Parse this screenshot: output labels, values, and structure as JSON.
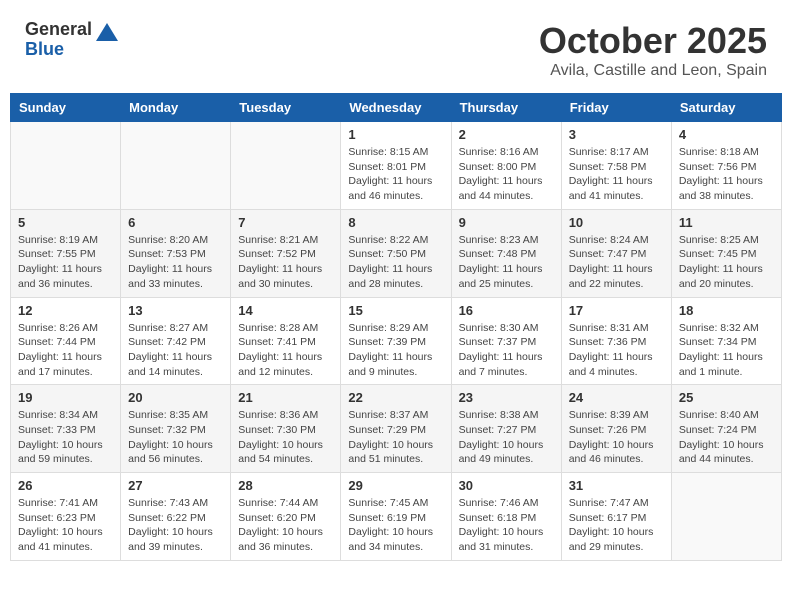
{
  "logo": {
    "general": "General",
    "blue": "Blue"
  },
  "title": {
    "month_year": "October 2025",
    "location": "Avila, Castille and Leon, Spain"
  },
  "weekdays": [
    "Sunday",
    "Monday",
    "Tuesday",
    "Wednesday",
    "Thursday",
    "Friday",
    "Saturday"
  ],
  "weeks": [
    [
      null,
      null,
      null,
      {
        "day": 1,
        "sunrise": "Sunrise: 8:15 AM",
        "sunset": "Sunset: 8:01 PM",
        "daylight": "Daylight: 11 hours and 46 minutes."
      },
      {
        "day": 2,
        "sunrise": "Sunrise: 8:16 AM",
        "sunset": "Sunset: 8:00 PM",
        "daylight": "Daylight: 11 hours and 44 minutes."
      },
      {
        "day": 3,
        "sunrise": "Sunrise: 8:17 AM",
        "sunset": "Sunset: 7:58 PM",
        "daylight": "Daylight: 11 hours and 41 minutes."
      },
      {
        "day": 4,
        "sunrise": "Sunrise: 8:18 AM",
        "sunset": "Sunset: 7:56 PM",
        "daylight": "Daylight: 11 hours and 38 minutes."
      }
    ],
    [
      {
        "day": 5,
        "sunrise": "Sunrise: 8:19 AM",
        "sunset": "Sunset: 7:55 PM",
        "daylight": "Daylight: 11 hours and 36 minutes."
      },
      {
        "day": 6,
        "sunrise": "Sunrise: 8:20 AM",
        "sunset": "Sunset: 7:53 PM",
        "daylight": "Daylight: 11 hours and 33 minutes."
      },
      {
        "day": 7,
        "sunrise": "Sunrise: 8:21 AM",
        "sunset": "Sunset: 7:52 PM",
        "daylight": "Daylight: 11 hours and 30 minutes."
      },
      {
        "day": 8,
        "sunrise": "Sunrise: 8:22 AM",
        "sunset": "Sunset: 7:50 PM",
        "daylight": "Daylight: 11 hours and 28 minutes."
      },
      {
        "day": 9,
        "sunrise": "Sunrise: 8:23 AM",
        "sunset": "Sunset: 7:48 PM",
        "daylight": "Daylight: 11 hours and 25 minutes."
      },
      {
        "day": 10,
        "sunrise": "Sunrise: 8:24 AM",
        "sunset": "Sunset: 7:47 PM",
        "daylight": "Daylight: 11 hours and 22 minutes."
      },
      {
        "day": 11,
        "sunrise": "Sunrise: 8:25 AM",
        "sunset": "Sunset: 7:45 PM",
        "daylight": "Daylight: 11 hours and 20 minutes."
      }
    ],
    [
      {
        "day": 12,
        "sunrise": "Sunrise: 8:26 AM",
        "sunset": "Sunset: 7:44 PM",
        "daylight": "Daylight: 11 hours and 17 minutes."
      },
      {
        "day": 13,
        "sunrise": "Sunrise: 8:27 AM",
        "sunset": "Sunset: 7:42 PM",
        "daylight": "Daylight: 11 hours and 14 minutes."
      },
      {
        "day": 14,
        "sunrise": "Sunrise: 8:28 AM",
        "sunset": "Sunset: 7:41 PM",
        "daylight": "Daylight: 11 hours and 12 minutes."
      },
      {
        "day": 15,
        "sunrise": "Sunrise: 8:29 AM",
        "sunset": "Sunset: 7:39 PM",
        "daylight": "Daylight: 11 hours and 9 minutes."
      },
      {
        "day": 16,
        "sunrise": "Sunrise: 8:30 AM",
        "sunset": "Sunset: 7:37 PM",
        "daylight": "Daylight: 11 hours and 7 minutes."
      },
      {
        "day": 17,
        "sunrise": "Sunrise: 8:31 AM",
        "sunset": "Sunset: 7:36 PM",
        "daylight": "Daylight: 11 hours and 4 minutes."
      },
      {
        "day": 18,
        "sunrise": "Sunrise: 8:32 AM",
        "sunset": "Sunset: 7:34 PM",
        "daylight": "Daylight: 11 hours and 1 minute."
      }
    ],
    [
      {
        "day": 19,
        "sunrise": "Sunrise: 8:34 AM",
        "sunset": "Sunset: 7:33 PM",
        "daylight": "Daylight: 10 hours and 59 minutes."
      },
      {
        "day": 20,
        "sunrise": "Sunrise: 8:35 AM",
        "sunset": "Sunset: 7:32 PM",
        "daylight": "Daylight: 10 hours and 56 minutes."
      },
      {
        "day": 21,
        "sunrise": "Sunrise: 8:36 AM",
        "sunset": "Sunset: 7:30 PM",
        "daylight": "Daylight: 10 hours and 54 minutes."
      },
      {
        "day": 22,
        "sunrise": "Sunrise: 8:37 AM",
        "sunset": "Sunset: 7:29 PM",
        "daylight": "Daylight: 10 hours and 51 minutes."
      },
      {
        "day": 23,
        "sunrise": "Sunrise: 8:38 AM",
        "sunset": "Sunset: 7:27 PM",
        "daylight": "Daylight: 10 hours and 49 minutes."
      },
      {
        "day": 24,
        "sunrise": "Sunrise: 8:39 AM",
        "sunset": "Sunset: 7:26 PM",
        "daylight": "Daylight: 10 hours and 46 minutes."
      },
      {
        "day": 25,
        "sunrise": "Sunrise: 8:40 AM",
        "sunset": "Sunset: 7:24 PM",
        "daylight": "Daylight: 10 hours and 44 minutes."
      }
    ],
    [
      {
        "day": 26,
        "sunrise": "Sunrise: 7:41 AM",
        "sunset": "Sunset: 6:23 PM",
        "daylight": "Daylight: 10 hours and 41 minutes."
      },
      {
        "day": 27,
        "sunrise": "Sunrise: 7:43 AM",
        "sunset": "Sunset: 6:22 PM",
        "daylight": "Daylight: 10 hours and 39 minutes."
      },
      {
        "day": 28,
        "sunrise": "Sunrise: 7:44 AM",
        "sunset": "Sunset: 6:20 PM",
        "daylight": "Daylight: 10 hours and 36 minutes."
      },
      {
        "day": 29,
        "sunrise": "Sunrise: 7:45 AM",
        "sunset": "Sunset: 6:19 PM",
        "daylight": "Daylight: 10 hours and 34 minutes."
      },
      {
        "day": 30,
        "sunrise": "Sunrise: 7:46 AM",
        "sunset": "Sunset: 6:18 PM",
        "daylight": "Daylight: 10 hours and 31 minutes."
      },
      {
        "day": 31,
        "sunrise": "Sunrise: 7:47 AM",
        "sunset": "Sunset: 6:17 PM",
        "daylight": "Daylight: 10 hours and 29 minutes."
      },
      null
    ]
  ]
}
